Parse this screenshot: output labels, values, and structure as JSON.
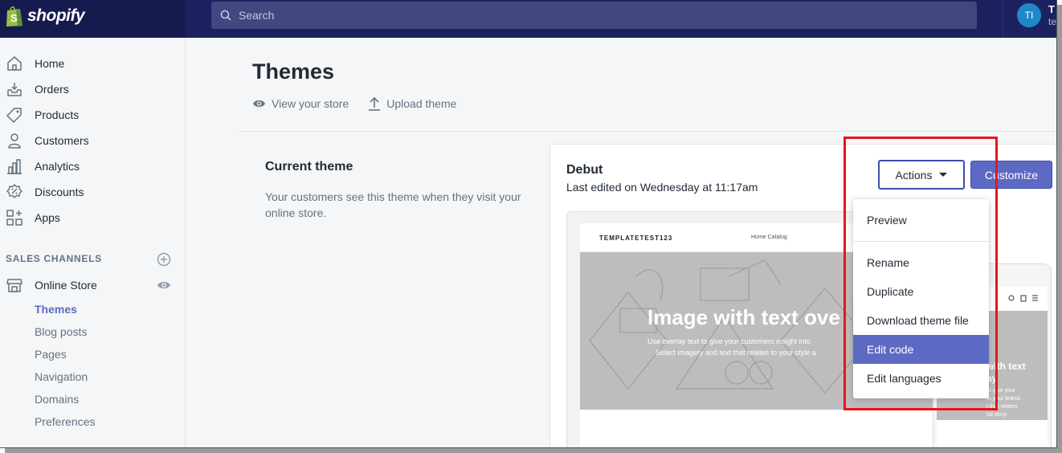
{
  "app": {
    "brand": "shopify"
  },
  "search": {
    "placeholder": "Search"
  },
  "user": {
    "initials": "TI",
    "name": "T",
    "sub": "te"
  },
  "sidebar": {
    "items": [
      {
        "label": "Home",
        "icon": "home-icon"
      },
      {
        "label": "Orders",
        "icon": "orders-icon"
      },
      {
        "label": "Products",
        "icon": "tag-icon"
      },
      {
        "label": "Customers",
        "icon": "person-icon"
      },
      {
        "label": "Analytics",
        "icon": "bar-chart-icon"
      },
      {
        "label": "Discounts",
        "icon": "discount-icon"
      },
      {
        "label": "Apps",
        "icon": "apps-icon"
      }
    ],
    "section_heading": "SALES CHANNELS",
    "channel": {
      "label": "Online Store",
      "icon": "store-icon"
    },
    "sub_items": [
      "Themes",
      "Blog posts",
      "Pages",
      "Navigation",
      "Domains",
      "Preferences"
    ]
  },
  "page": {
    "title": "Themes",
    "actions": {
      "view_store": "View your store",
      "upload_theme": "Upload theme"
    }
  },
  "current_theme": {
    "title": "Current theme",
    "description": "Your customers see this theme when they visit your online store.",
    "name": "Debut",
    "last_edited": "Last edited on Wednesday at 11:17am",
    "actions_label": "Actions",
    "customize_label": "Customize"
  },
  "preview": {
    "store_name": "TEMPLATETEST123",
    "nav_links": "Home    Catalog",
    "hero_title": "Image with text ove",
    "hero_text_1": "Use overlay text to give your customers insight into",
    "hero_text_2": "Select imagery and text that relates to your style a",
    "mobile_title_1": "with text",
    "mobile_title_2": "ay",
    "mobile_text_1": "to give your",
    "mobile_text_2": "to your brand.",
    "mobile_text_3": "t that relates",
    "mobile_text_4": "nd story."
  },
  "dropdown": {
    "items": [
      "Preview",
      "Rename",
      "Duplicate",
      "Download theme file",
      "Edit code",
      "Edit languages"
    ],
    "highlighted": "Edit code"
  },
  "colors": {
    "accent": "#5c6ac4",
    "topbar": "#1c2260",
    "annotation": "#e8141b"
  }
}
